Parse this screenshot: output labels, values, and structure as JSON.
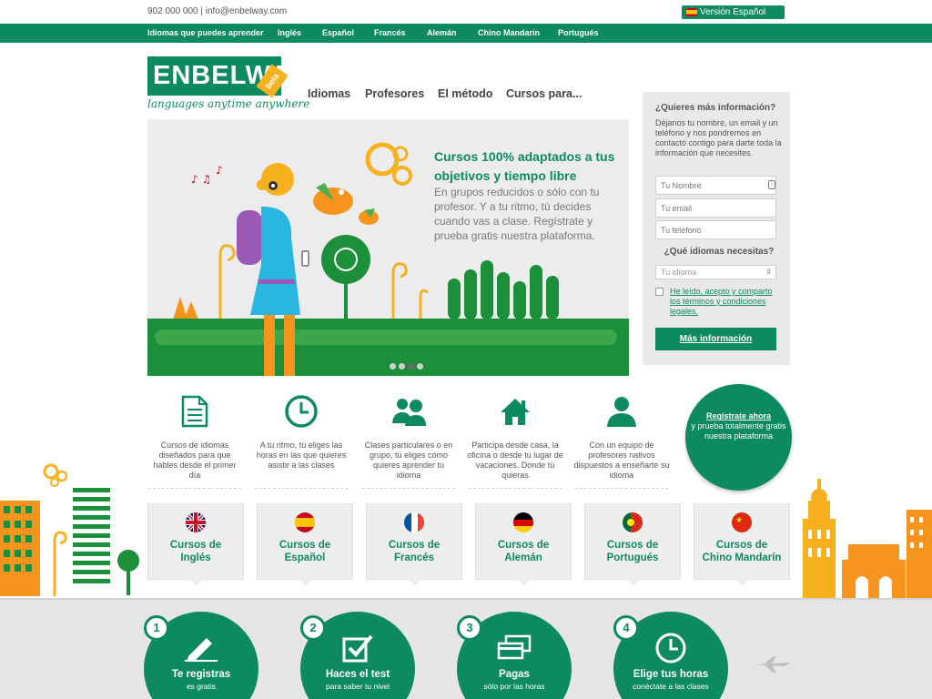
{
  "top": {
    "contact": "902 000 000 | info@enbelway.com",
    "version_button": "Versión Español"
  },
  "topnav": [
    "Idiomas que puedes aprender",
    "Inglés",
    "Español",
    "Francés",
    "Alemán",
    "Chino Mandarín",
    "Portugués"
  ],
  "logo": {
    "name": "ENBELWAY",
    "badge": "beta",
    "tagline": "languages anytime anywhere"
  },
  "mainnav": [
    "Idiomas",
    "Profesores",
    "El método",
    "Cursos para..."
  ],
  "hero": {
    "title": "Cursos 100% adaptados a tus objetivos y tiempo libre",
    "text": "En grupos reducidos o sólo con tu profesor. Y a tu ritmo, tú decides cuando vas a clase. Regístrate y prueba gratis nuestra plataforma.",
    "slides": 4,
    "active_slide": 3
  },
  "form": {
    "title": "¿Quieres más información?",
    "intro": "Déjanos tu nombre, un email y un teléfono y nos pondremos en contacto contigo para darte toda la información que necesites.",
    "name_placeholder": "Tu Nombre",
    "email_placeholder": "Tu email",
    "phone_placeholder": "Tu teléfono",
    "languages_question": "¿Qué idiomas necesitas?",
    "language_select": "Tu idioma",
    "legal": "He leído, acepto y comparto los términos y condiciones legales.",
    "submit": "Más información"
  },
  "features": [
    {
      "icon": "document-icon",
      "text": "Cursos de idiomas diseñados para que hables desde el primer día"
    },
    {
      "icon": "clock-icon",
      "text": "A tu ritmo, tú eliges las horas en las que quieres asistir a las clases"
    },
    {
      "icon": "group-icon",
      "text": "Clases particulares o en grupo, tú eliges cómo quieres aprender tu idioma"
    },
    {
      "icon": "home-icon",
      "text": "Participa desde casa, la oficina o desde tu lugar de vacaciones. Donde tú quieras"
    },
    {
      "icon": "person-icon",
      "text": "Con un equipo de profesores nativos dispuestos a enseñarte su idioma"
    }
  ],
  "cta": {
    "link": "Regístrate ahora",
    "text": "y prueba totalmente gratis nuestra plataforma"
  },
  "courses": [
    {
      "line1": "Cursos de",
      "line2": "Inglés",
      "flag": "uk-flag-icon"
    },
    {
      "line1": "Cursos de",
      "line2": "Español",
      "flag": "spain-flag-icon"
    },
    {
      "line1": "Cursos de",
      "line2": "Francés",
      "flag": "france-flag-icon"
    },
    {
      "line1": "Cursos de",
      "line2": "Alemán",
      "flag": "germany-flag-icon"
    },
    {
      "line1": "Cursos de",
      "line2": "Portugués",
      "flag": "portugal-flag-icon"
    },
    {
      "line1": "Cursos de",
      "line2": "Chino Mandarín",
      "flag": "china-flag-icon"
    }
  ],
  "steps": [
    {
      "num": "1",
      "title": "Te registras",
      "sub": "es gratis",
      "icon": "pencil-icon"
    },
    {
      "num": "2",
      "title": "Haces el test",
      "sub": "para saber tu nivel",
      "icon": "checkbox-icon"
    },
    {
      "num": "3",
      "title": "Pagas",
      "sub": "sólo por las horas",
      "icon": "cards-icon"
    },
    {
      "num": "4",
      "title": "Elige tus horas",
      "sub": "conéctate a las clases",
      "icon": "clock-icon"
    }
  ],
  "colors": {
    "brand_green": "#0e8a5f",
    "accent_orange": "#f7941d",
    "accent_yellow": "#f7b11f"
  }
}
